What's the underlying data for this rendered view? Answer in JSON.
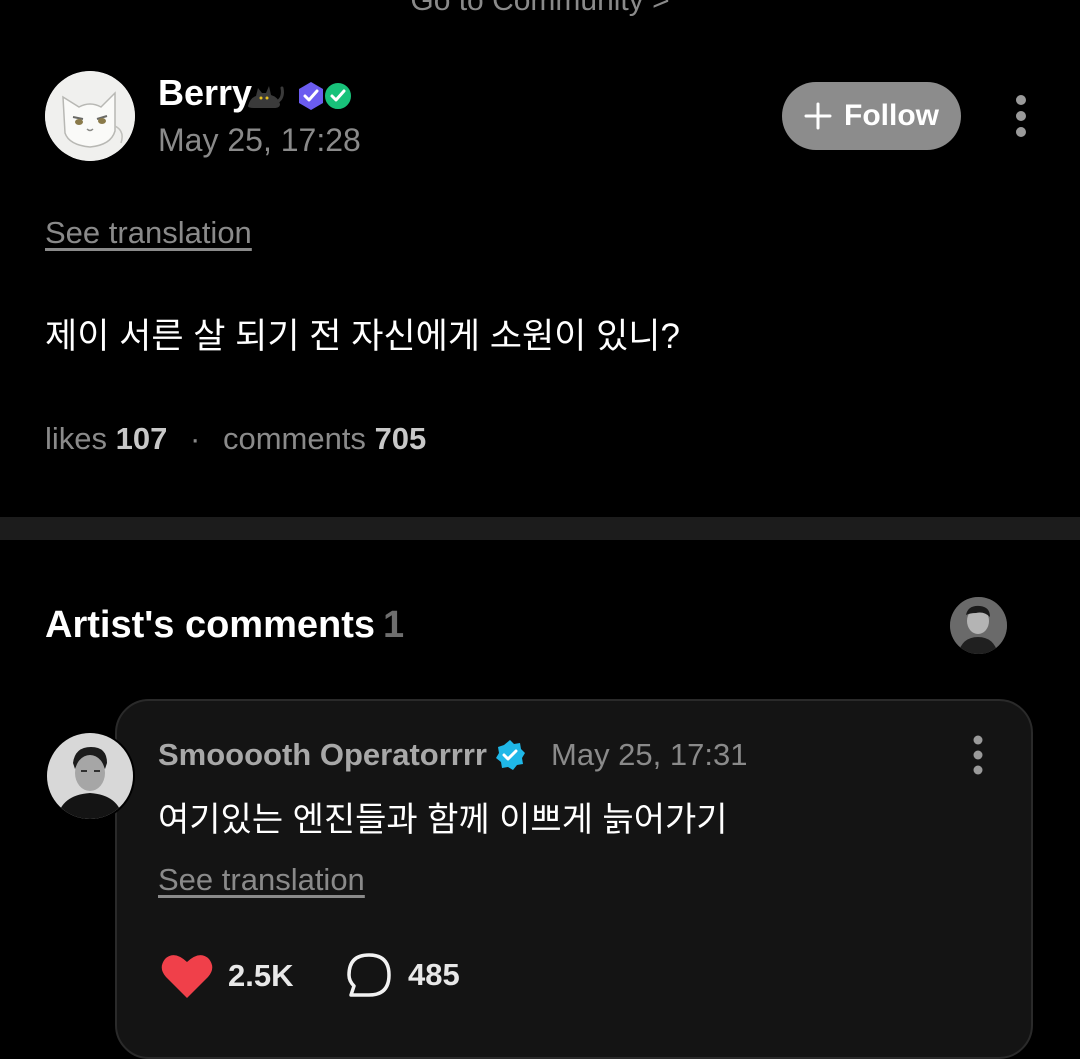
{
  "top_link": {
    "label": "Go to Community >"
  },
  "post": {
    "author_name": "Berry",
    "date": "May 25, 17:28",
    "follow_label": "Follow",
    "see_translation": "See translation",
    "body": "제이 서른 살 되기 전 자신에게 소원이 있니?",
    "stats": {
      "likes_label": "likes",
      "likes_value": "107",
      "separator": "·",
      "comments_label": "comments",
      "comments_value": "705"
    }
  },
  "artist_comments": {
    "title": "Artist's comments",
    "count": "1",
    "comment": {
      "author": "Smooooth Operatorrrr",
      "date": "May 25, 17:31",
      "body": "여기있는 엔진들과 함께 이쁘게 늙어가기",
      "see_translation": "See translation",
      "likes": "2.5K",
      "replies": "485"
    }
  },
  "colors": {
    "background": "#000000",
    "muted_text": "#8a8a8a",
    "follow_button": "#8c8c8c",
    "card_background": "#141414",
    "heart": "#f0404a",
    "verified": "#1fb8e8",
    "badge_purple": "#6b5cf0",
    "badge_green": "#18c27a"
  },
  "icons": {
    "cat": "black-cat-emoji",
    "badge_a": "purple-check-badge",
    "badge_b": "green-check-badge",
    "plus": "plus-icon",
    "more": "vertical-ellipsis-icon",
    "verified": "verified-check-icon",
    "heart": "heart-icon",
    "reply": "speech-bubble-icon"
  }
}
